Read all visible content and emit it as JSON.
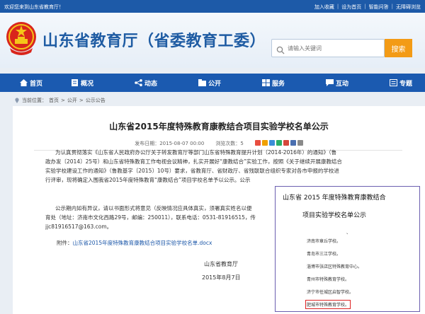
{
  "topbar": {
    "welcome": "欢迎您来到山东省教育厅！",
    "links": [
      "加入收藏",
      "设为首页",
      "智能问答",
      "无障碍浏览"
    ]
  },
  "header": {
    "site_title": "山东省教育厅（省委教育工委）",
    "search_placeholder": "请输入关键词",
    "search_button": "搜索"
  },
  "nav": [
    {
      "label": "首页",
      "icon": "home-icon"
    },
    {
      "label": "概况",
      "icon": "document-icon"
    },
    {
      "label": "动态",
      "icon": "share-icon"
    },
    {
      "label": "公开",
      "icon": "folder-icon"
    },
    {
      "label": "服务",
      "icon": "service-icon"
    },
    {
      "label": "互动",
      "icon": "chat-icon"
    },
    {
      "label": "专题",
      "icon": "topic-icon"
    }
  ],
  "breadcrumb": {
    "prefix": "当前位置：",
    "items": [
      "首页",
      "公开",
      "公示公告"
    ]
  },
  "article": {
    "title": "山东省2015年度特殊教育康教结合项目实验学校名单公示",
    "date_label": "发布日期：",
    "date": "2015-08-07 00:00",
    "views_label": "浏览次数：",
    "views": "5",
    "p1_lines": [
      "为认真贯彻落实《山东省人民政府办公厅关于转发教育厅等部门山东省特殊教育提升计划（2014-2016年）的通知》（鲁",
      "政办发〔2014〕25号）和山东省特殊教育工作电视会议精神，扎实开展好“康教结合”实验工作，按照《关于继续开展康教结合",
      "实验学校建设工作的通知》（鲁教基字〔2015〕10号）要求，省教育厅、省财政厅、省残联联合组织专家对各市申报的学校进",
      "行评审，现将确定入围我省2015年度特殊教育“康教结合”项目学校名单予以公示。公示"
    ],
    "p2_lines": [
      "公示期内如有异议，请以书面形式将意见（反映情况应具体真实，须署真实姓名以便",
      "育处（地址：济南市文化西路29号，邮编：250011），联系电话：0531-81916515，传",
      "jjc81916517@163.com。"
    ],
    "attachment_label": "附件：",
    "attachment_link": "山东省2015年度特殊教育康教结合项目实验学校名单.docx",
    "sign_org": "山东省教育厅",
    "sign_date": "2015年8月7日"
  },
  "overlay": {
    "title_line1": "山东省 2015 年度特殊教育康教结合",
    "title_line2": "项目实验学校名单公示",
    "dot": "、",
    "schools": [
      "济南市章丘学校。",
      "青岛市三江学校。",
      "淄博市张店区特殊教育中心。",
      "青州市特殊教育学校。",
      "济宁市任城区启智学校。",
      "肥城市特殊教育学校。"
    ]
  },
  "colors": {
    "topbar": "#1d5aa8",
    "nav": "#1b5ab0",
    "title_blue": "#1f5ca3",
    "search_button": "#f39b16",
    "highlight": "#dd2222"
  }
}
